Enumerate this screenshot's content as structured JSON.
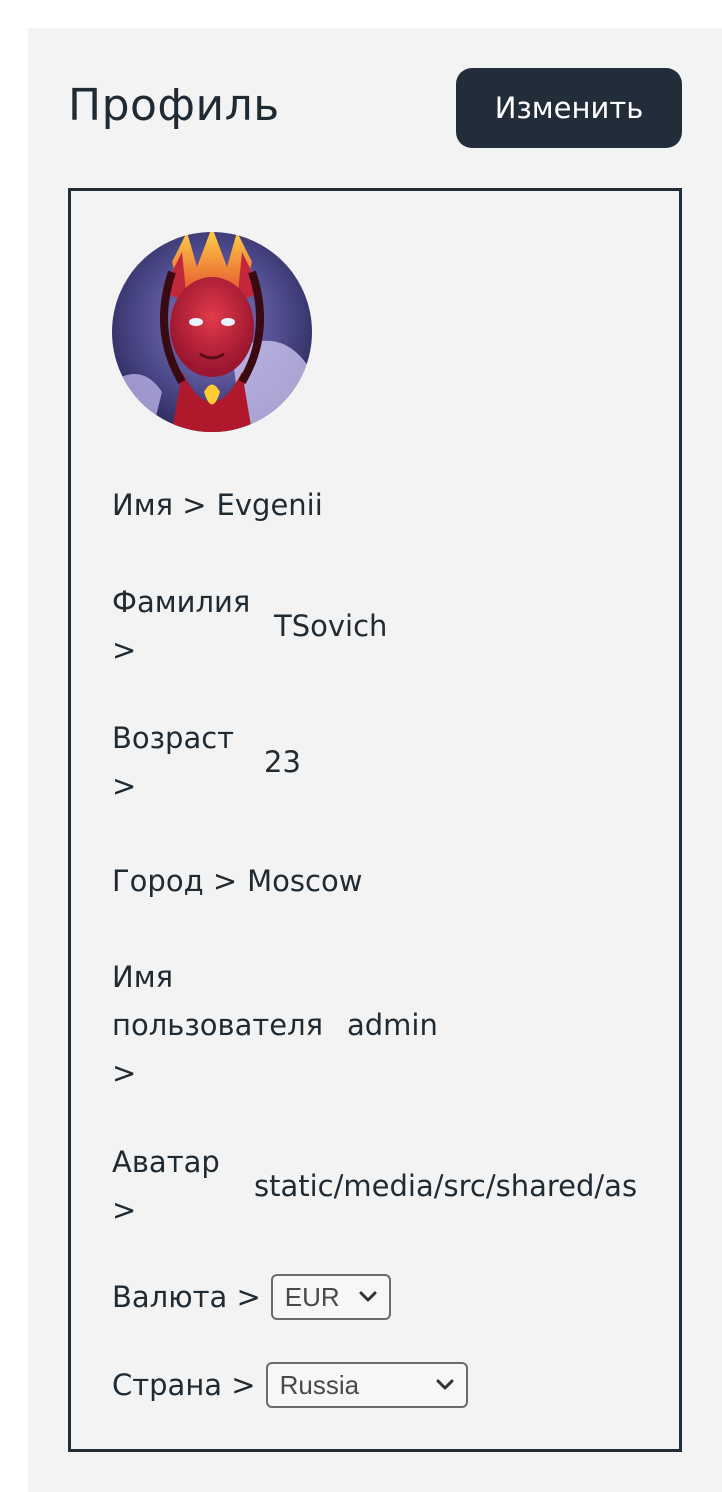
{
  "header": {
    "title": "Профиль",
    "edit_label": "Изменить"
  },
  "profile": {
    "avatar_icon": "avatar-image",
    "fields": {
      "first_name": {
        "label_line1": "Имя >",
        "value": "Evgenii"
      },
      "last_name": {
        "label_line1": "Фамилия",
        "label_line2": ">",
        "value": "TSovich"
      },
      "age": {
        "label_line1": "Возраст",
        "label_line2": ">",
        "value": "23"
      },
      "city": {
        "label_line1": "Город >",
        "value": "Moscow"
      },
      "username": {
        "label_line1": "Имя",
        "label_line2": "пользователя",
        "label_line3": ">",
        "value": "admin"
      },
      "avatar_path": {
        "label_line1": "Аватар",
        "label_line2": ">",
        "value": "static/media/src/shared/as"
      },
      "currency": {
        "label": "Валюта >",
        "selected": "EUR"
      },
      "country": {
        "label": "Страна >",
        "selected": "Russia"
      }
    }
  },
  "colors": {
    "dark": "#212d38",
    "panel_bg": "#f3f3f3"
  }
}
